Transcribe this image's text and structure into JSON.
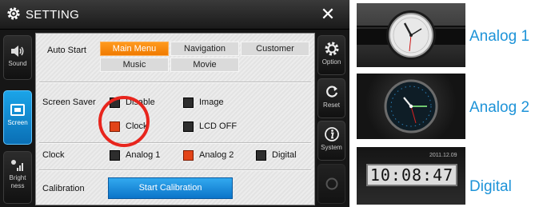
{
  "window": {
    "title": "SETTING",
    "close_glyph": "✕"
  },
  "sidebar_left": [
    {
      "label": "Sound",
      "icon": "speaker-icon",
      "active": false
    },
    {
      "label": "Screen",
      "icon": "screen-icon",
      "active": true
    },
    {
      "label_line1": "Bright",
      "label_line2": "ness",
      "icon": "brightness-icon",
      "active": false
    }
  ],
  "sidebar_right": [
    {
      "label": "Option",
      "icon": "gear-icon"
    },
    {
      "label": "Reset",
      "icon": "refresh-icon"
    },
    {
      "label": "System",
      "icon": "info-icon"
    },
    {
      "label": "",
      "icon": "ring-icon"
    }
  ],
  "auto_start": {
    "label": "Auto Start",
    "options": [
      "Main Menu",
      "Navigation",
      "Customer",
      "Music",
      "Movie"
    ],
    "selected": "Main Menu"
  },
  "screen_saver": {
    "label": "Screen Saver",
    "options": [
      "Disable",
      "Image",
      "Clock",
      "LCD OFF"
    ],
    "selected": "Clock"
  },
  "clock": {
    "label": "Clock",
    "options": [
      "Analog 1",
      "Analog 2",
      "Digital"
    ],
    "selected": "Analog 2"
  },
  "calibration": {
    "label": "Calibration",
    "button": "Start Calibration"
  },
  "previews": [
    {
      "caption": "Analog 1"
    },
    {
      "caption": "Analog 2"
    },
    {
      "caption": "Digital",
      "time": "10:08:47",
      "date": "2011.12.09"
    }
  ],
  "colors": {
    "accent_orange": "#f07a00",
    "accent_blue": "#1ba4e8",
    "caption_blue": "#1d93d8",
    "highlight_red": "#e8251d"
  }
}
